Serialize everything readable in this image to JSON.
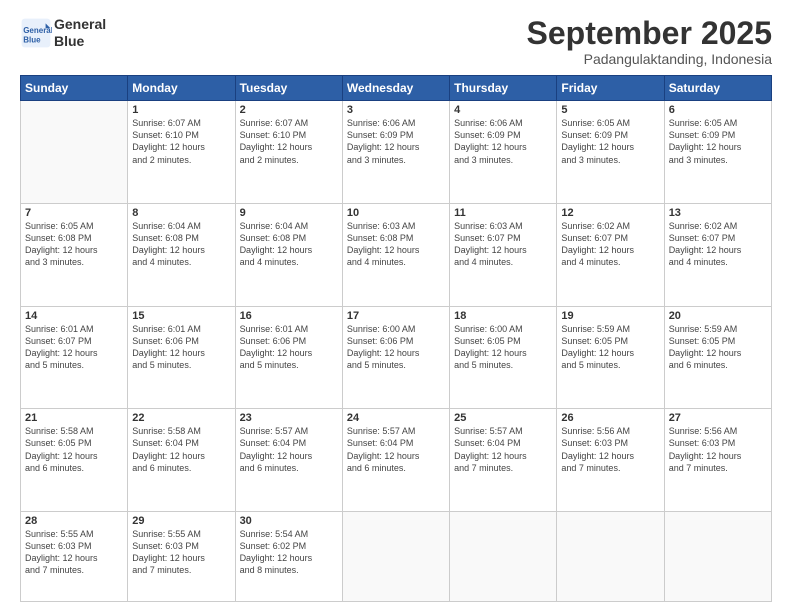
{
  "logo": {
    "line1": "General",
    "line2": "Blue"
  },
  "title": "September 2025",
  "subtitle": "Padangulaktanding, Indonesia",
  "weekdays": [
    "Sunday",
    "Monday",
    "Tuesday",
    "Wednesday",
    "Thursday",
    "Friday",
    "Saturday"
  ],
  "weeks": [
    [
      {
        "day": "",
        "detail": ""
      },
      {
        "day": "1",
        "detail": "Sunrise: 6:07 AM\nSunset: 6:10 PM\nDaylight: 12 hours\nand 2 minutes."
      },
      {
        "day": "2",
        "detail": "Sunrise: 6:07 AM\nSunset: 6:10 PM\nDaylight: 12 hours\nand 2 minutes."
      },
      {
        "day": "3",
        "detail": "Sunrise: 6:06 AM\nSunset: 6:09 PM\nDaylight: 12 hours\nand 3 minutes."
      },
      {
        "day": "4",
        "detail": "Sunrise: 6:06 AM\nSunset: 6:09 PM\nDaylight: 12 hours\nand 3 minutes."
      },
      {
        "day": "5",
        "detail": "Sunrise: 6:05 AM\nSunset: 6:09 PM\nDaylight: 12 hours\nand 3 minutes."
      },
      {
        "day": "6",
        "detail": "Sunrise: 6:05 AM\nSunset: 6:09 PM\nDaylight: 12 hours\nand 3 minutes."
      }
    ],
    [
      {
        "day": "7",
        "detail": "Sunrise: 6:05 AM\nSunset: 6:08 PM\nDaylight: 12 hours\nand 3 minutes."
      },
      {
        "day": "8",
        "detail": "Sunrise: 6:04 AM\nSunset: 6:08 PM\nDaylight: 12 hours\nand 4 minutes."
      },
      {
        "day": "9",
        "detail": "Sunrise: 6:04 AM\nSunset: 6:08 PM\nDaylight: 12 hours\nand 4 minutes."
      },
      {
        "day": "10",
        "detail": "Sunrise: 6:03 AM\nSunset: 6:08 PM\nDaylight: 12 hours\nand 4 minutes."
      },
      {
        "day": "11",
        "detail": "Sunrise: 6:03 AM\nSunset: 6:07 PM\nDaylight: 12 hours\nand 4 minutes."
      },
      {
        "day": "12",
        "detail": "Sunrise: 6:02 AM\nSunset: 6:07 PM\nDaylight: 12 hours\nand 4 minutes."
      },
      {
        "day": "13",
        "detail": "Sunrise: 6:02 AM\nSunset: 6:07 PM\nDaylight: 12 hours\nand 4 minutes."
      }
    ],
    [
      {
        "day": "14",
        "detail": "Sunrise: 6:01 AM\nSunset: 6:07 PM\nDaylight: 12 hours\nand 5 minutes."
      },
      {
        "day": "15",
        "detail": "Sunrise: 6:01 AM\nSunset: 6:06 PM\nDaylight: 12 hours\nand 5 minutes."
      },
      {
        "day": "16",
        "detail": "Sunrise: 6:01 AM\nSunset: 6:06 PM\nDaylight: 12 hours\nand 5 minutes."
      },
      {
        "day": "17",
        "detail": "Sunrise: 6:00 AM\nSunset: 6:06 PM\nDaylight: 12 hours\nand 5 minutes."
      },
      {
        "day": "18",
        "detail": "Sunrise: 6:00 AM\nSunset: 6:05 PM\nDaylight: 12 hours\nand 5 minutes."
      },
      {
        "day": "19",
        "detail": "Sunrise: 5:59 AM\nSunset: 6:05 PM\nDaylight: 12 hours\nand 5 minutes."
      },
      {
        "day": "20",
        "detail": "Sunrise: 5:59 AM\nSunset: 6:05 PM\nDaylight: 12 hours\nand 6 minutes."
      }
    ],
    [
      {
        "day": "21",
        "detail": "Sunrise: 5:58 AM\nSunset: 6:05 PM\nDaylight: 12 hours\nand 6 minutes."
      },
      {
        "day": "22",
        "detail": "Sunrise: 5:58 AM\nSunset: 6:04 PM\nDaylight: 12 hours\nand 6 minutes."
      },
      {
        "day": "23",
        "detail": "Sunrise: 5:57 AM\nSunset: 6:04 PM\nDaylight: 12 hours\nand 6 minutes."
      },
      {
        "day": "24",
        "detail": "Sunrise: 5:57 AM\nSunset: 6:04 PM\nDaylight: 12 hours\nand 6 minutes."
      },
      {
        "day": "25",
        "detail": "Sunrise: 5:57 AM\nSunset: 6:04 PM\nDaylight: 12 hours\nand 7 minutes."
      },
      {
        "day": "26",
        "detail": "Sunrise: 5:56 AM\nSunset: 6:03 PM\nDaylight: 12 hours\nand 7 minutes."
      },
      {
        "day": "27",
        "detail": "Sunrise: 5:56 AM\nSunset: 6:03 PM\nDaylight: 12 hours\nand 7 minutes."
      }
    ],
    [
      {
        "day": "28",
        "detail": "Sunrise: 5:55 AM\nSunset: 6:03 PM\nDaylight: 12 hours\nand 7 minutes."
      },
      {
        "day": "29",
        "detail": "Sunrise: 5:55 AM\nSunset: 6:03 PM\nDaylight: 12 hours\nand 7 minutes."
      },
      {
        "day": "30",
        "detail": "Sunrise: 5:54 AM\nSunset: 6:02 PM\nDaylight: 12 hours\nand 8 minutes."
      },
      {
        "day": "",
        "detail": ""
      },
      {
        "day": "",
        "detail": ""
      },
      {
        "day": "",
        "detail": ""
      },
      {
        "day": "",
        "detail": ""
      }
    ]
  ]
}
